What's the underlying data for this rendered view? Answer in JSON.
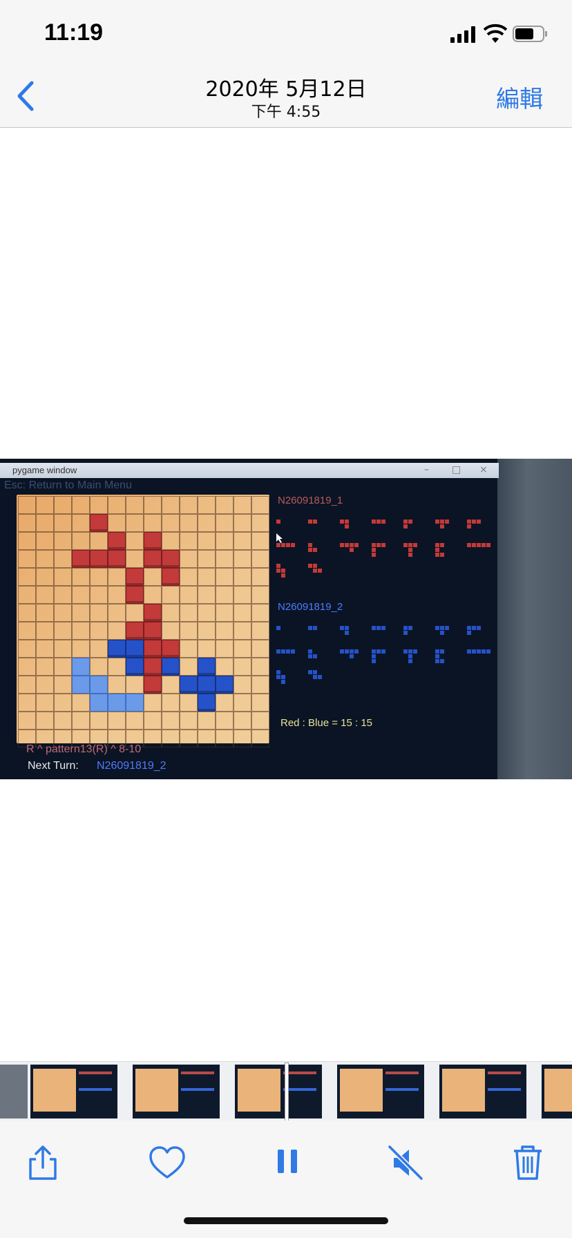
{
  "status_bar": {
    "time": "11:19"
  },
  "nav": {
    "title": "2020年 5月12日",
    "subtitle": "下午 4:55",
    "edit_label": "編輯"
  },
  "window": {
    "title": "pygame window",
    "menu_hint": "Esc: Return to Main Menu",
    "player1": "N26091819_1",
    "player2": "N26091819_2",
    "score": "Red : Blue = 15 : 15",
    "last_move": "R ^ pattern13(R) ^ 8-10",
    "next_turn_label": "Next Turn:",
    "next_turn_value": "N26091819_2"
  },
  "colors": {
    "accent": "#2f7ae5",
    "red_piece": "#c23a3a",
    "blue_piece": "#2652c9",
    "board": "#efc690"
  },
  "toolbar": {
    "icons": [
      "share-icon",
      "heart-icon",
      "pause-icon",
      "mute-icon",
      "trash-icon"
    ]
  }
}
